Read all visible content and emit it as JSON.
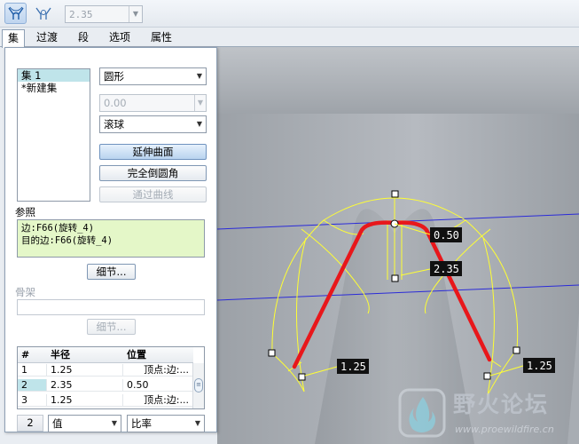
{
  "toolbar": {
    "set_mode_icon": "round-set-mode-icon",
    "transition_mode_icon": "transition-mode-icon",
    "radius_value": "2.35"
  },
  "tabs": [
    {
      "label": "集",
      "active": true
    },
    {
      "label": "过渡",
      "active": false
    },
    {
      "label": "段",
      "active": false
    },
    {
      "label": "选项",
      "active": false
    },
    {
      "label": "属性",
      "active": false
    }
  ],
  "panel": {
    "sets": [
      "集 1",
      "*新建集"
    ],
    "shape_dropdown": "圆形",
    "value_dropdown": "0.00",
    "method_dropdown": "滚球",
    "extend_surfaces_button": "延伸曲面",
    "full_round_button": "完全倒圆角",
    "through_curve_button": "通过曲线",
    "references_label": "参照",
    "references": [
      "边:F66(旋转_4)",
      "目的边:F66(旋转_4)"
    ],
    "details_button": "细节...",
    "skeleton_label": "骨架",
    "skeleton_details_button": "细节...",
    "table": {
      "headers": [
        "#",
        "半径",
        "位置"
      ],
      "rows": [
        {
          "idx": "1",
          "radius": "1.25",
          "position": "顶点:边:..."
        },
        {
          "idx": "2",
          "radius": "2.35",
          "position": "0.50"
        },
        {
          "idx": "3",
          "radius": "1.25",
          "position": "顶点:边:..."
        }
      ]
    },
    "footer": {
      "count": "2",
      "value_dropdown": "值",
      "ratio_dropdown": "比率"
    }
  },
  "viewport": {
    "dimensions": [
      "0.50",
      "2.35",
      "1.25",
      "1.25"
    ]
  },
  "watermark": {
    "title": "野火论坛",
    "url": "www.proewildfire.cn"
  },
  "colors": {
    "accent_selection": "#bfe4ea",
    "reference_box": "#e4f7c8",
    "edge_highlight": "#e8171b",
    "preview_curve": "#ffff33"
  }
}
